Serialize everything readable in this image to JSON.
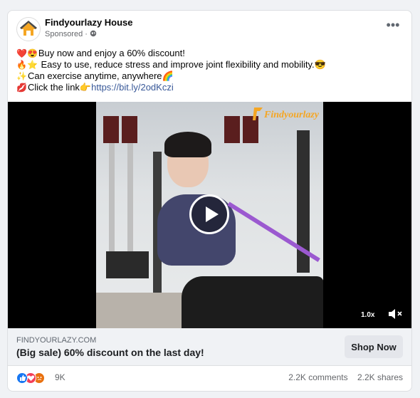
{
  "post": {
    "page_name": "Findyourlazy House",
    "sponsored": "Sponsored ·",
    "more_label": "•••",
    "text_lines": [
      {
        "emoji": "❤️😍",
        "text": "Buy now and enjoy a 60% discount!"
      },
      {
        "emoji": "🔥⭐",
        "text": " Easy to use, reduce stress and improve joint flexibility and mobility.😎"
      },
      {
        "emoji": "✨",
        "text": "Can exercise anytime, anywhere🌈"
      },
      {
        "emoji": "💋",
        "text": "Click the link👉"
      }
    ],
    "link": "https://bit.ly/2odKczi"
  },
  "video": {
    "watermark": "Findyourlazy",
    "speed": "1.0x",
    "play_icon": "play-icon",
    "volume_icon": "volume-muted-icon"
  },
  "cta": {
    "domain": "FINDYOURLAZY.COM",
    "headline": "(Big sale)  60% discount on the last day!",
    "button": "Shop Now"
  },
  "footer": {
    "reaction_count": "9K",
    "comments": "2.2K comments",
    "shares": "2.2K shares",
    "reaction_icons": [
      "like-icon",
      "love-icon",
      "angry-icon"
    ]
  },
  "colors": {
    "link": "#385898",
    "like": "#1877f2",
    "love": "#f33e58",
    "angry": "#e9710f"
  }
}
